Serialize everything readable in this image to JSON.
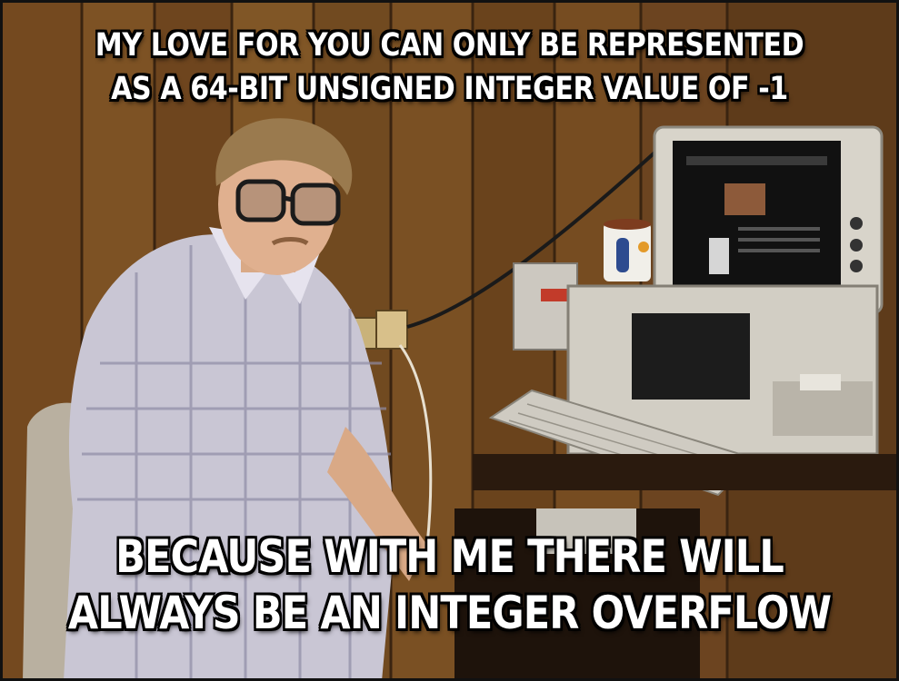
{
  "meme": {
    "top_caption": {
      "line1": "MY LOVE FOR YOU CAN ONLY BE REPRESENTED",
      "line2": "AS A 64-BIT UNSIGNED INTEGER VALUE OF -1"
    },
    "bottom_caption": {
      "line1": "BECAUSE WITH ME THERE WILL",
      "line2": "ALWAYS BE AN INTEGER OVERFLOW"
    }
  }
}
